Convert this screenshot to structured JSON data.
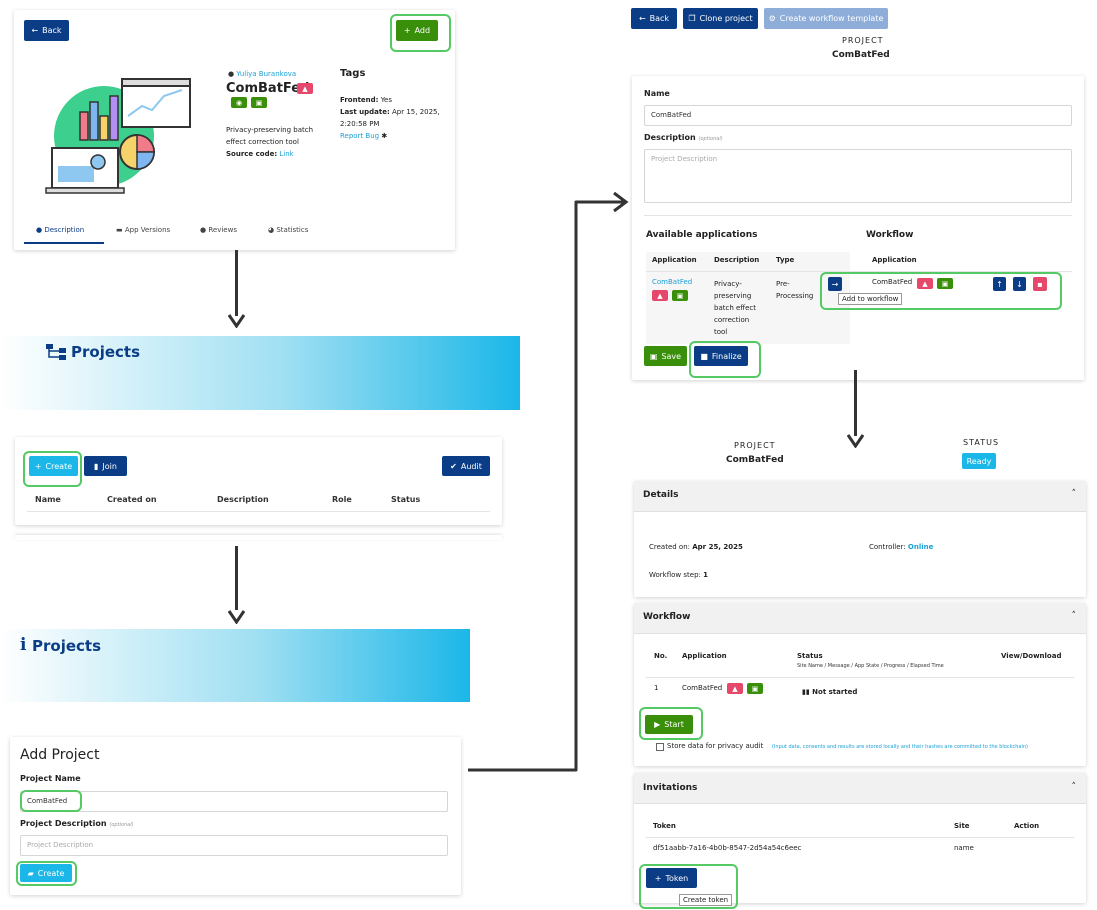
{
  "app_detail": {
    "back_label": "Back",
    "add_label": "Add",
    "author": "Yuliya Burankova",
    "app_name": "ComBatFed",
    "description_lines": [
      "Privacy-preserving batch",
      "effect correction tool"
    ],
    "source_code_label": "Source code:",
    "source_code_link": "Link",
    "tags_title": "Tags",
    "frontend_label": "Frontend:",
    "frontend_value": "Yes",
    "last_update_label": "Last update:",
    "last_update_value": "Apr 15, 2025,",
    "last_update_time": "2:20:58 PM",
    "report_bug": "Report Bug",
    "tabs": [
      {
        "label": "Description",
        "icon": "info-icon"
      },
      {
        "label": "App Versions",
        "icon": "versions-icon"
      },
      {
        "label": "Reviews",
        "icon": "reviews-icon"
      },
      {
        "label": "Statistics",
        "icon": "statistics-icon"
      }
    ]
  },
  "projects_banner_1": {
    "title": "Projects"
  },
  "projects_list": {
    "create_label": "Create",
    "join_label": "Join",
    "audit_label": "Audit",
    "columns": [
      "Name",
      "Created on",
      "Description",
      "Role",
      "Status"
    ]
  },
  "projects_banner_2": {
    "title": "Projects"
  },
  "add_project": {
    "title": "Add Project",
    "name_label": "Project Name",
    "name_value": "ComBatFed",
    "description_label": "Project Description",
    "optional": "(optional)",
    "description_placeholder": "Project Description",
    "create_label": "Create"
  },
  "project_setup": {
    "back_label": "Back",
    "clone_label": "Clone project",
    "template_label": "Create workflow template",
    "project_caption": "PROJECT",
    "project_name": "ComBatFed",
    "name_label": "Name",
    "name_value": "ComBatFed",
    "description_label": "Description",
    "optional": "(optional)",
    "description_placeholder": "Project Description",
    "available_title": "Available applications",
    "workflow_title": "Workflow",
    "available_columns": [
      "Application",
      "Description",
      "Type"
    ],
    "workflow_column": "Application",
    "app_link": "ComBatFed",
    "app_description_lines": [
      "Privacy-",
      "preserving",
      "batch effect",
      "correction",
      "tool"
    ],
    "app_type_lines": [
      "Pre-",
      "Processing"
    ],
    "workflow_app": "ComBatFed",
    "add_tooltip": "Add to workflow",
    "save_label": "Save",
    "finalize_label": "Finalize"
  },
  "project_status": {
    "project_caption": "PROJECT",
    "project_name": "ComBatFed",
    "status_caption": "STATUS",
    "status_value": "Ready",
    "details_title": "Details",
    "created_label": "Created on:",
    "created_value": "Apr 25, 2025",
    "controller_label": "Controller:",
    "controller_value": "Online",
    "step_label": "Workflow step:",
    "step_value": "1",
    "workflow_title": "Workflow",
    "workflow_columns": {
      "no": "No.",
      "application": "Application",
      "status": "Status",
      "status_sub": "Site Name / Message / App State / Progress / Elapsed Time",
      "view": "View/Download"
    },
    "workflow_row": {
      "no": "1",
      "application": "ComBatFed",
      "status": "Not started"
    },
    "start_label": "Start",
    "store_label": "Store data for privacy audit",
    "store_note": "(Input data, consents and results are stored locally and their hashes are committed to the blockchain)",
    "invitations_title": "Invitations",
    "invitation_columns": [
      "Token",
      "Site",
      "Action"
    ],
    "invitation_row": {
      "token": "df51aabb-7a16-4b0b-8547-2d54a54c6eec",
      "site": "name"
    },
    "token_label": "Token",
    "token_tooltip": "Create token"
  },
  "colors": {
    "navy": "#0b3d86",
    "green": "#3a8f0a",
    "cyan": "#1bb7e8",
    "red": "#e5486a",
    "highlight": "#55c963"
  }
}
